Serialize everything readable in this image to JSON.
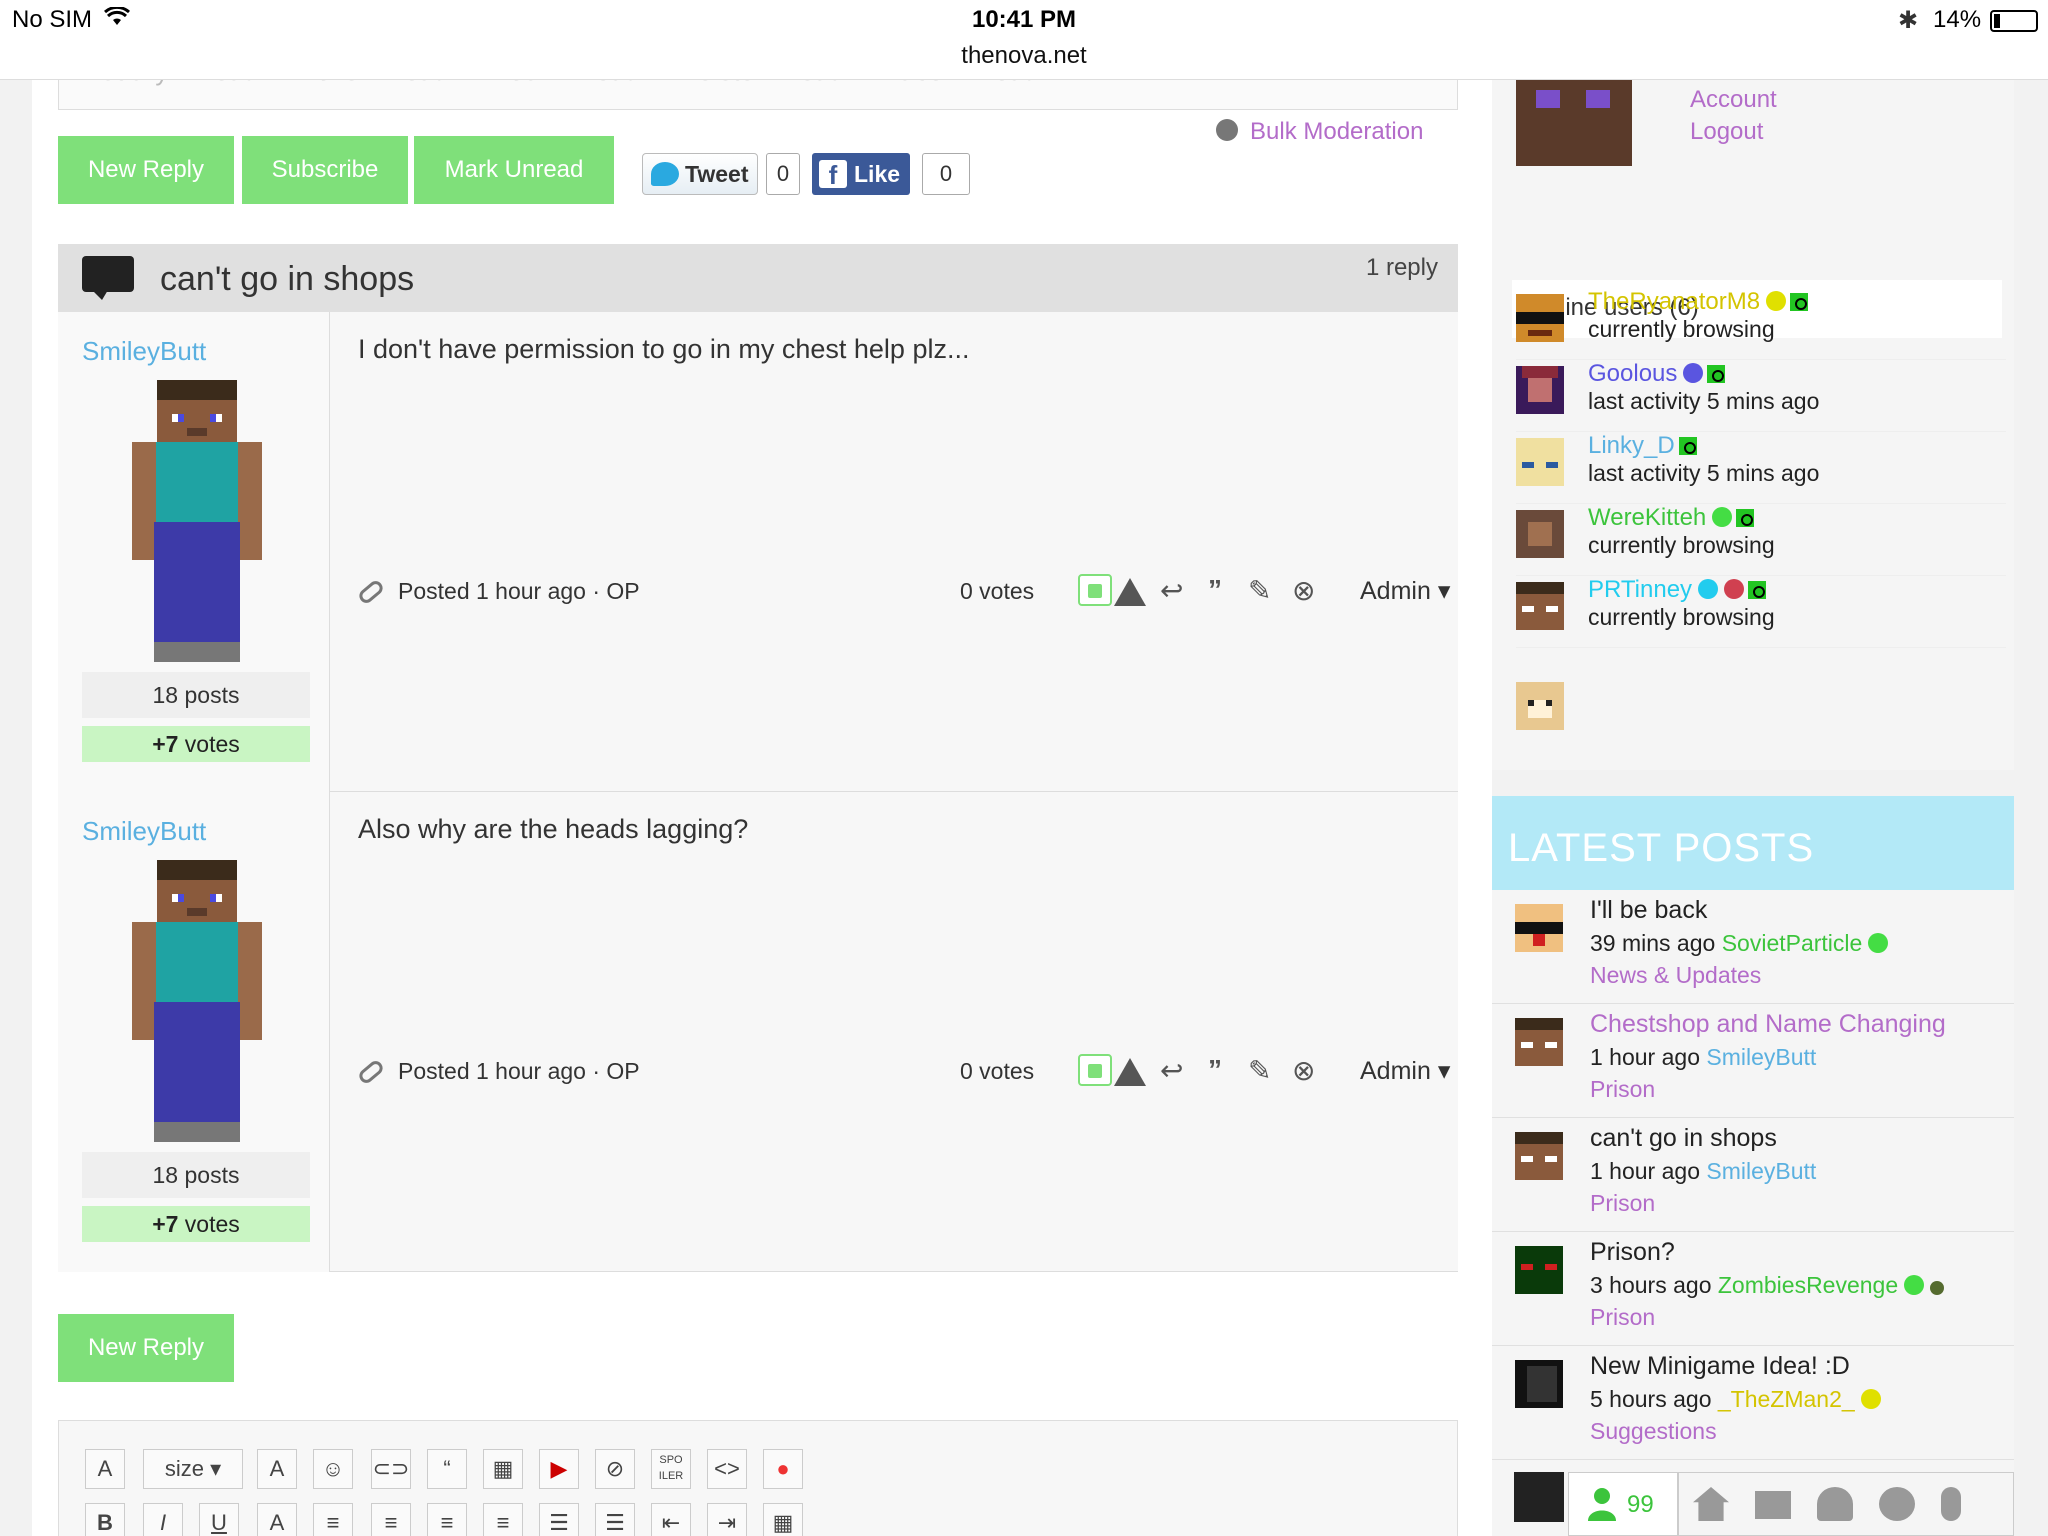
{
  "status_bar": {
    "carrier": "No SIM",
    "time": "10:41 PM",
    "url": "thenova.net",
    "battery": "14%"
  },
  "mod_tools": [
    "Sticky Thread",
    "Move Thread",
    "Lock Thread",
    "Delete Thread",
    "Label Thread"
  ],
  "bulk_moderation": "Bulk Moderation",
  "actions": {
    "new_reply": "New Reply",
    "subscribe": "Subscribe",
    "mark_unread": "Mark Unread",
    "tweet": "Tweet",
    "tweet_count": "0",
    "like": "Like",
    "like_count": "0"
  },
  "thread": {
    "title": "can't go in shops",
    "reply_count": "1 reply"
  },
  "posts": [
    {
      "author": "SmileyButt",
      "posts": "18 posts",
      "votes_badge_bold": "+7",
      "votes_badge": " votes",
      "body": "I don't have permission to go in my chest help plz...",
      "meta": "Posted 1 hour ago · OP",
      "votes": "0  votes",
      "admin": "Admin"
    },
    {
      "author": "SmileyButt",
      "posts": "18 posts",
      "votes_badge_bold": "+7",
      "votes_badge": " votes",
      "body": "Also why are the heads lagging?",
      "meta": "Posted 1 hour ago · OP",
      "votes": "0  votes",
      "admin": "Admin"
    }
  ],
  "bottom_new_reply": "New Reply",
  "editor": {
    "size_label": "size",
    "spoiler_label": "SPO\nILER"
  },
  "sidebar": {
    "account": "Account",
    "logout": "Logout",
    "online_label": "Online users (6)",
    "online_users": [
      {
        "name": "TheRyanatorM8",
        "status": "currently browsing",
        "color": "#d4c400"
      },
      {
        "name": "Goolous",
        "status": "last activity 5 mins ago",
        "color": "#5a55e0"
      },
      {
        "name": "Linky_D",
        "status": "last activity 5 mins ago",
        "color": "#5ab0e0"
      },
      {
        "name": "WereKitteh",
        "status": "currently browsing",
        "color": "#3cc43c"
      },
      {
        "name": "PRTinney",
        "status": "currently browsing",
        "color": "#22ccee"
      }
    ],
    "latest_title": "LATEST POSTS",
    "latest_posts": [
      {
        "title": "I'll be back",
        "time": "39 mins ago",
        "user": "SovietParticle",
        "user_color": "#3cc43c",
        "category": "News & Updates"
      },
      {
        "title": "Chestshop and Name Changing",
        "time": "1 hour ago",
        "user": "SmileyButt",
        "user_color": "#5ab0e0",
        "category": "Prison"
      },
      {
        "title": "can't go in shops",
        "time": "1 hour ago",
        "user": "SmileyButt",
        "user_color": "#5ab0e0",
        "category": "Prison"
      },
      {
        "title": "Prison?",
        "time": "3 hours ago",
        "user": "ZombiesRevenge",
        "user_color": "#3cc43c",
        "category": "Prison"
      },
      {
        "title": "New Minigame Idea! :D",
        "time": "5 hours ago",
        "user": "_TheZMan2_",
        "user_color": "#d4c400",
        "category": "Suggestions"
      }
    ],
    "online_count": "99"
  }
}
